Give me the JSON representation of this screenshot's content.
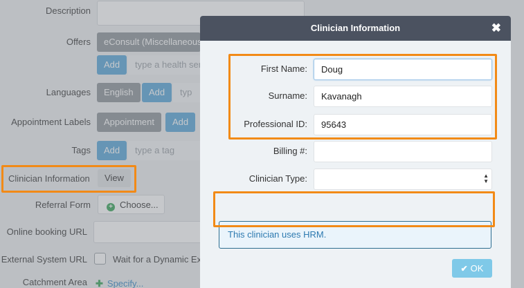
{
  "form": {
    "description_label": "Description",
    "offers_label": "Offers",
    "offers_chip": "eConsult (Miscellaneous",
    "offers_add": "Add",
    "offers_placeholder": "type a health ser",
    "languages_label": "Languages",
    "languages_chip": "English",
    "languages_add": "Add",
    "languages_placeholder": "typ",
    "appointment_labels_label": "Appointment Labels",
    "appointment_chip": "Appointment",
    "appointment_add": "Add",
    "tags_label": "Tags",
    "tags_add": "Add",
    "tags_placeholder": "type a tag",
    "clinician_info_label": "Clinician Information",
    "clinician_view": "View",
    "referral_form_label": "Referral Form",
    "referral_choose": "Choose...",
    "online_booking_label": "Online booking URL",
    "external_system_label": "External System URL",
    "external_wait_text": "Wait for a Dynamic Ext",
    "catchment_label": "Catchment Area",
    "catchment_specify": "Specify..."
  },
  "modal": {
    "title": "Clinician Information",
    "close_icon": "close-icon",
    "first_name_label": "First Name:",
    "first_name_value": "Doug",
    "surname_label": "Surname:",
    "surname_value": "Kavanagh",
    "professional_id_label": "Professional ID:",
    "professional_id_value": "95643",
    "billing_label": "Billing #:",
    "billing_value": "",
    "clinician_type_label": "Clinician Type:",
    "clinician_type_value": "",
    "hrm_notice": "This clinician uses HRM.",
    "ok_label": "OK"
  },
  "colors": {
    "highlight": "#f28a16",
    "modal_header": "#4b5260",
    "ok_button": "#7fc9e8",
    "add_button": "#5aa8da"
  }
}
